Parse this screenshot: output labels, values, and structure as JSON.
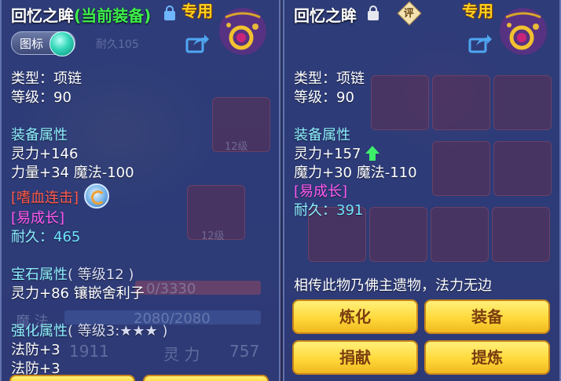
{
  "left": {
    "title": "回忆之眸",
    "title_status": "(当前装备)",
    "bound_label": "专用",
    "icon_toggle_label": "图标",
    "type_line": "类型：项链",
    "level_line": "等级：90",
    "attr_title": "装备属性",
    "attr_lines": [
      "灵力+146",
      "力量+34 魔法-100"
    ],
    "skill": "[嗜血连击]",
    "growth": "[易成长]",
    "durability_label": "耐久：",
    "durability_value": "465",
    "gem_title": "宝石属性",
    "gem_level": "( 等级12 )",
    "gem_line": "灵力+86 镶嵌舍利子",
    "enhance_title": "强化属性",
    "enhance_level": "( 等级3:★★★ )",
    "enhance_lines": [
      "法防+3",
      "法防+3"
    ],
    "bg": {
      "item_level_1": "12级",
      "item_level_2": "12级",
      "durability_fragment": "耐久105",
      "hp_fragment": "0/3330",
      "mp_label": "魔 法",
      "mp_value": "2080/2080",
      "stat_left": "1911",
      "stat_label": "灵 力",
      "stat_value": "757"
    }
  },
  "right": {
    "title": "回忆之眸",
    "rate_badge": "评",
    "bound_label": "专用",
    "type_line": "类型：项链",
    "level_line": "等级：90",
    "attr_title": "装备属性",
    "attr_lines": [
      "灵力+157",
      "魔力+30 魔法-110"
    ],
    "growth": "[易成长]",
    "durability_label": "耐久：",
    "durability_value": "391",
    "description": "相传此物乃佛主遗物，法力无边",
    "buttons": [
      "炼化",
      "装备",
      "捐献",
      "提炼"
    ]
  },
  "colors": {
    "panel": "#303e80",
    "current_equip": "#3df04a",
    "bound": "#ffd21a",
    "section": "#8ef0ff",
    "skill": "#ff5a48",
    "growth": "#ff5af0",
    "button": "#ffd93a",
    "button_text": "#7a3d10"
  },
  "icons": [
    "lock-icon",
    "unlock-icon",
    "necklace-icon",
    "share-icon",
    "skill-icon",
    "up-arrow-icon",
    "rate-badge-icon"
  ]
}
